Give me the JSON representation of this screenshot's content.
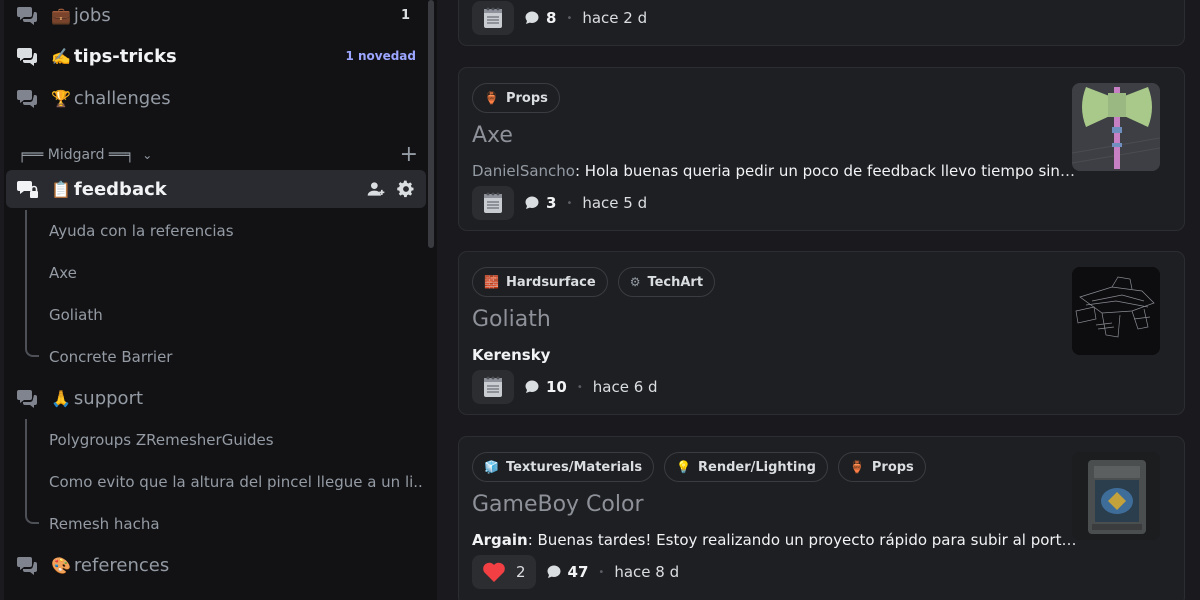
{
  "sidebar": {
    "channels": [
      {
        "emoji": "💼",
        "name": "jobs",
        "badge": "1"
      },
      {
        "emoji": "✍️",
        "name": "tips-tricks",
        "badge": "1 novedad"
      },
      {
        "emoji": "🏆",
        "name": "challenges"
      }
    ],
    "category": {
      "label": "╒══ Midgard ══╕",
      "chevron": "⌄",
      "add": "+"
    },
    "feedback": {
      "emoji": "📋",
      "name": "feedback"
    },
    "feedback_threads": [
      "Ayuda con la referencias",
      "Axe",
      "Goliath",
      "Concrete Barrier"
    ],
    "support": {
      "emoji": "🙏",
      "name": "support"
    },
    "support_threads": [
      "Polygroups ZRemesherGuides",
      "Como evito que la altura del pincel llegue a un li...",
      "Remesh hacha"
    ],
    "references": {
      "emoji": "🎨",
      "name": "references"
    }
  },
  "posts": [
    {
      "comments": "8",
      "time": "hace 2 d"
    },
    {
      "tags": [
        {
          "icon": "🏺",
          "label": "Props"
        }
      ],
      "title": "Axe",
      "author": "DanielSancho",
      "message": "Hola buenas queria pedir un poco de feedback llevo tiempo sin t...",
      "comments": "3",
      "time": "hace 5 d"
    },
    {
      "tags": [
        {
          "icon": "🧱",
          "label": "Hardsurface"
        },
        {
          "icon": "⚙",
          "label": "TechArt"
        }
      ],
      "title": "Goliath",
      "author": "Kerensky",
      "comments": "10",
      "time": "hace 6 d"
    },
    {
      "tags": [
        {
          "icon": "🧊",
          "label": "Textures/Materials"
        },
        {
          "icon": "💡",
          "label": "Render/Lighting"
        },
        {
          "icon": "🏺",
          "label": "Props"
        }
      ],
      "title": "GameBoy Color",
      "author": "Argain",
      "message": "Buenas tardes! Estoy realizando un proyecto rápido para subir al portfol...",
      "reactions": "2",
      "comments": "47",
      "time": "hace 8 d"
    }
  ],
  "colors": {
    "accent_new": "#9ca6ff",
    "heart": "#f23f43",
    "sidebar_bg": "#121214",
    "card_bg": "#1e1f22"
  }
}
